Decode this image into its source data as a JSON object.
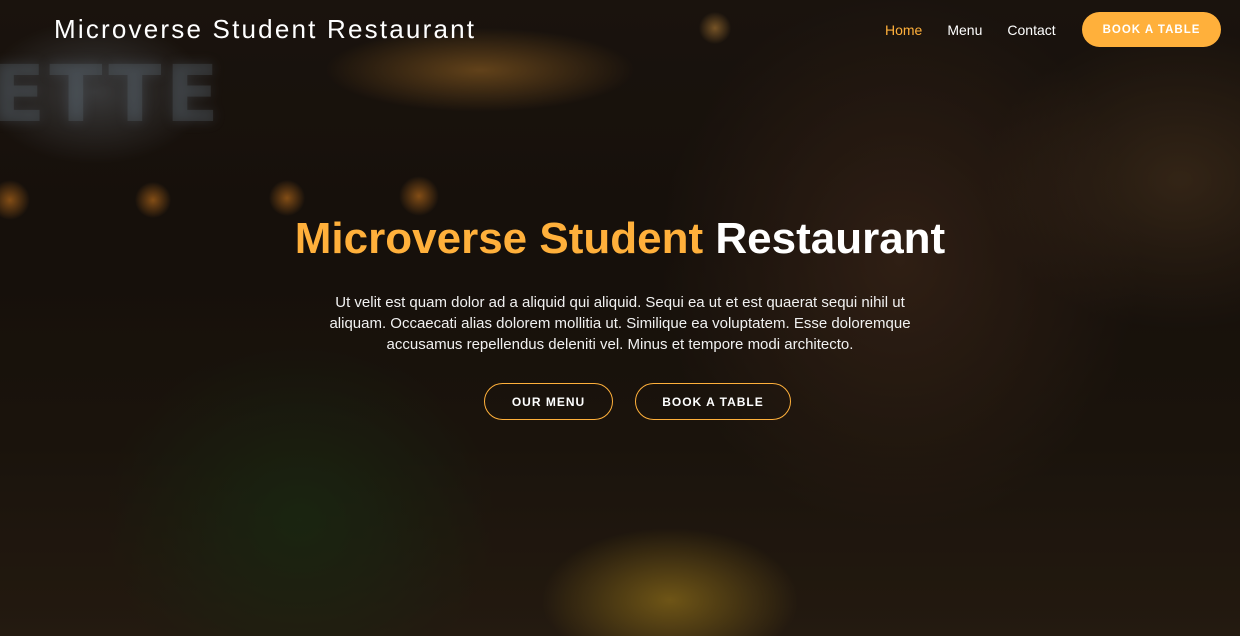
{
  "brand": {
    "name": "Microverse Student Restaurant",
    "accent_color": "#ffb03b"
  },
  "nav": {
    "items": [
      {
        "label": "Home",
        "active": true
      },
      {
        "label": "Menu",
        "active": false
      },
      {
        "label": "Contact",
        "active": false
      }
    ],
    "cta_label": "Book a Table"
  },
  "hero": {
    "title_accent": "Microverse Student",
    "title_rest": "Restaurant",
    "description": "Ut velit est quam dolor ad a aliquid qui aliquid. Sequi ea ut et est quaerat sequi nihil ut aliquam. Occaecati alias dolorem mollitia ut. Similique ea voluptatem. Esse doloremque accusamus repellendus deleniti vel. Minus et tempore modi architecto.",
    "buttons": {
      "menu_label": "Our Menu",
      "table_label": "Book a Table"
    }
  },
  "background": {
    "sign_text": "ETTE"
  }
}
